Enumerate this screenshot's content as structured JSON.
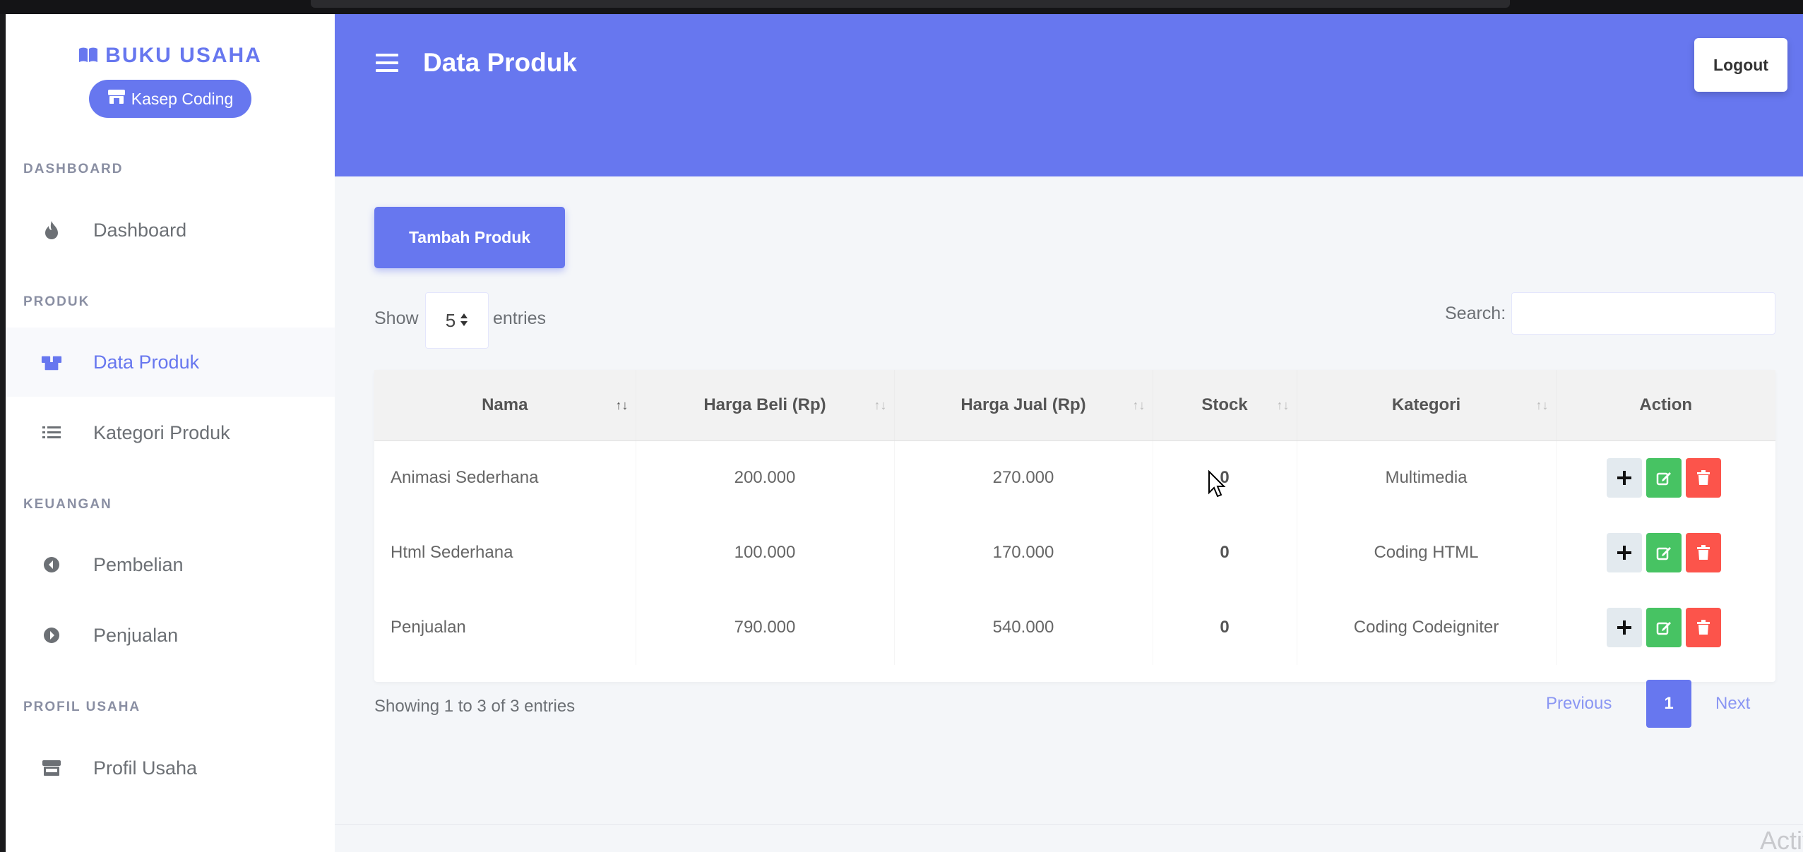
{
  "brand": {
    "name": "BUKU USAHA",
    "store": "Kasep Coding"
  },
  "sidebar": {
    "sections": [
      {
        "header": "DASHBOARD",
        "items": [
          {
            "label": "Dashboard",
            "icon": "fire-icon"
          }
        ]
      },
      {
        "header": "PRODUK",
        "items": [
          {
            "label": "Data Produk",
            "icon": "boxes-icon",
            "active": true
          },
          {
            "label": "Kategori Produk",
            "icon": "list-icon"
          }
        ]
      },
      {
        "header": "KEUANGAN",
        "items": [
          {
            "label": "Pembelian",
            "icon": "arrow-circle-left-icon"
          },
          {
            "label": "Penjualan",
            "icon": "arrow-circle-right-icon"
          }
        ]
      },
      {
        "header": "PROFIL USAHA",
        "items": [
          {
            "label": "Profil Usaha",
            "icon": "store-icon"
          }
        ]
      }
    ]
  },
  "header": {
    "title": "Data Produk",
    "logout": "Logout"
  },
  "toolbar": {
    "add_label": "Tambah Produk",
    "show_label": "Show",
    "entries_value": "5",
    "entries_label": "entries",
    "search_label": "Search:"
  },
  "table": {
    "columns": [
      "Nama",
      "Harga Beli (Rp)",
      "Harga Jual (Rp)",
      "Stock",
      "Kategori",
      "Action"
    ],
    "rows": [
      {
        "nama": "Animasi Sederhana",
        "beli": "200.000",
        "jual": "270.000",
        "stock": "0",
        "kategori": "Multimedia"
      },
      {
        "nama": "Html Sederhana",
        "beli": "100.000",
        "jual": "170.000",
        "stock": "0",
        "kategori": "Coding HTML"
      },
      {
        "nama": "Penjualan",
        "beli": "790.000",
        "jual": "540.000",
        "stock": "0",
        "kategori": "Coding Codeigniter"
      }
    ]
  },
  "footer": {
    "showing": "Showing 1 to 3 of 3 entries",
    "previous": "Previous",
    "page": "1",
    "next": "Next"
  },
  "watermark": "Activate Windows",
  "colors": {
    "primary": "#6777ef",
    "success": "#47c363",
    "danger": "#fc544b",
    "light": "#e3eaef"
  }
}
